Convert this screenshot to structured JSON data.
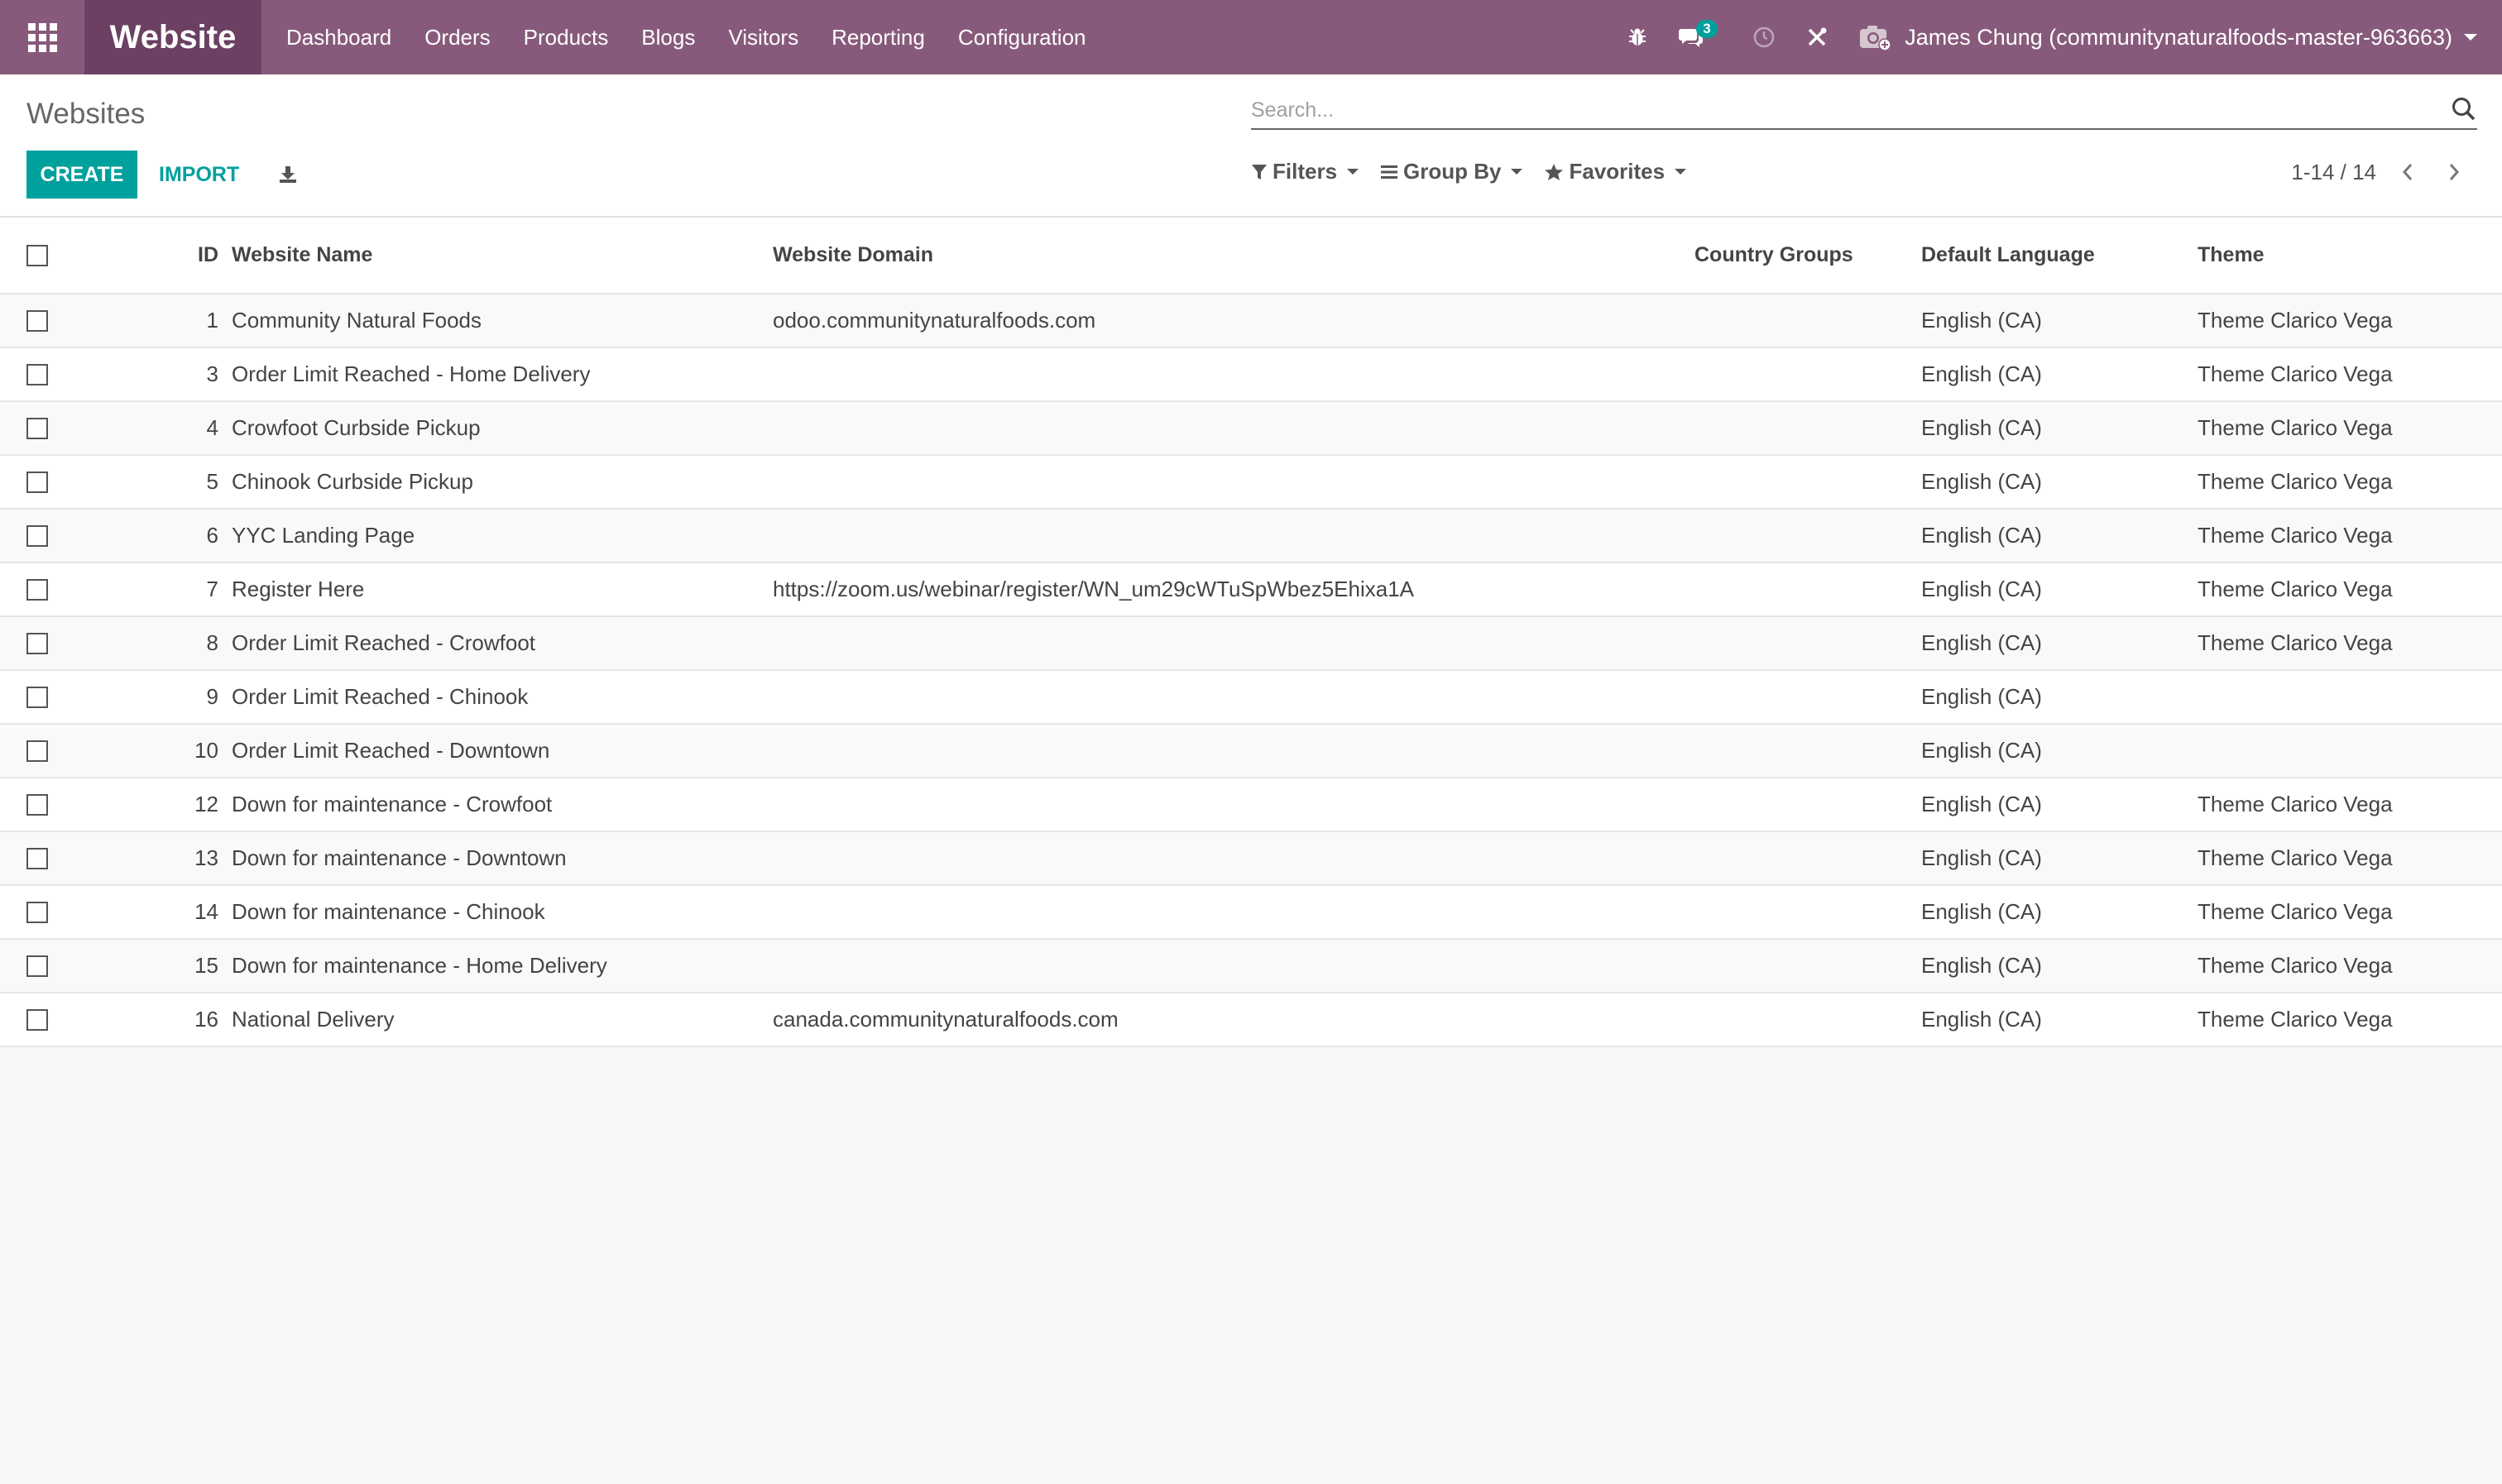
{
  "navbar": {
    "brand": "Website",
    "menu": [
      "Dashboard",
      "Orders",
      "Products",
      "Blogs",
      "Visitors",
      "Reporting",
      "Configuration"
    ],
    "messages_badge": "3",
    "user": "James Chung (communitynaturalfoods-master-963663)",
    "tray_icons": [
      "bug-icon",
      "chat-icon",
      "clock-icon",
      "tools-icon"
    ],
    "bg_color": "#875a7b",
    "brand_bg_color": "#6b4062"
  },
  "control_panel": {
    "breadcrumb": "Websites",
    "search_placeholder": "Search...",
    "create_label": "CREATE",
    "import_label": "IMPORT",
    "filters_label": "Filters",
    "groupby_label": "Group By",
    "favorites_label": "Favorites",
    "pager": "1-14 / 14",
    "accent_color": "#00a09d"
  },
  "table": {
    "headers": {
      "id": "ID",
      "name": "Website Name",
      "domain": "Website Domain",
      "country_groups": "Country Groups",
      "language": "Default Language",
      "theme": "Theme"
    },
    "rows": [
      {
        "id": "1",
        "name": "Community Natural Foods",
        "domain": "odoo.communitynaturalfoods.com",
        "country_groups": "",
        "language": "English (CA)",
        "theme": "Theme Clarico Vega"
      },
      {
        "id": "3",
        "name": "Order Limit Reached - Home Delivery",
        "domain": "",
        "country_groups": "",
        "language": "English (CA)",
        "theme": "Theme Clarico Vega"
      },
      {
        "id": "4",
        "name": "Crowfoot Curbside Pickup",
        "domain": "",
        "country_groups": "",
        "language": "English (CA)",
        "theme": "Theme Clarico Vega"
      },
      {
        "id": "5",
        "name": "Chinook Curbside Pickup",
        "domain": "",
        "country_groups": "",
        "language": "English (CA)",
        "theme": "Theme Clarico Vega"
      },
      {
        "id": "6",
        "name": "YYC Landing Page",
        "domain": "",
        "country_groups": "",
        "language": "English (CA)",
        "theme": "Theme Clarico Vega"
      },
      {
        "id": "7",
        "name": "Register Here",
        "domain": "https://zoom.us/webinar/register/WN_um29cWTuSpWbez5Ehixa1A",
        "country_groups": "",
        "language": "English (CA)",
        "theme": "Theme Clarico Vega"
      },
      {
        "id": "8",
        "name": "Order Limit Reached - Crowfoot",
        "domain": "",
        "country_groups": "",
        "language": "English (CA)",
        "theme": "Theme Clarico Vega"
      },
      {
        "id": "9",
        "name": "Order Limit Reached - Chinook",
        "domain": "",
        "country_groups": "",
        "language": "English (CA)",
        "theme": ""
      },
      {
        "id": "10",
        "name": "Order Limit Reached - Downtown",
        "domain": "",
        "country_groups": "",
        "language": "English (CA)",
        "theme": ""
      },
      {
        "id": "12",
        "name": "Down for maintenance - Crowfoot",
        "domain": "",
        "country_groups": "",
        "language": "English (CA)",
        "theme": "Theme Clarico Vega"
      },
      {
        "id": "13",
        "name": "Down for maintenance - Downtown",
        "domain": "",
        "country_groups": "",
        "language": "English (CA)",
        "theme": "Theme Clarico Vega"
      },
      {
        "id": "14",
        "name": "Down for maintenance - Chinook",
        "domain": "",
        "country_groups": "",
        "language": "English (CA)",
        "theme": "Theme Clarico Vega"
      },
      {
        "id": "15",
        "name": "Down for maintenance - Home Delivery",
        "domain": "",
        "country_groups": "",
        "language": "English (CA)",
        "theme": "Theme Clarico Vega"
      },
      {
        "id": "16",
        "name": "National Delivery",
        "domain": "canada.communitynaturalfoods.com",
        "country_groups": "",
        "language": "English (CA)",
        "theme": "Theme Clarico Vega"
      }
    ]
  }
}
